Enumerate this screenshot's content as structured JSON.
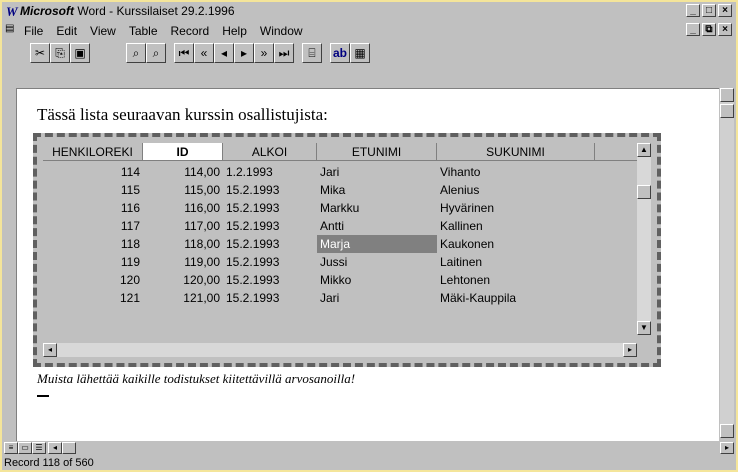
{
  "window": {
    "app_name": "Microsoft",
    "title_rest": " Word - Kurssilaiset 29.2.1996"
  },
  "menu": [
    "File",
    "Edit",
    "View",
    "Table",
    "Record",
    "Help",
    "Window"
  ],
  "toolbar": {
    "buttons": [
      "cut-icon",
      "copy-icon",
      "paste-icon",
      "find-icon",
      "find-next-icon",
      "first-record-icon",
      "prev-page-icon",
      "prev-record-icon",
      "next-record-icon",
      "next-page-icon",
      "last-record-icon",
      "print-preview-icon",
      "field-icon",
      "form-icon"
    ]
  },
  "document": {
    "heading": "Tässä lista seuraavan kurssin osallistujista:",
    "note": "Muista lähettää kaikille todistukset kiitettävillä arvosanoilla!"
  },
  "table": {
    "columns": [
      "HENKILOREKI",
      "ID",
      "ALKOI",
      "ETUNIMI",
      "SUKUNIMI"
    ],
    "rows": [
      [
        "114",
        "114,00",
        "1.2.1993",
        "Jari",
        "Vihanto"
      ],
      [
        "115",
        "115,00",
        "15.2.1993",
        "Mika",
        "Alenius"
      ],
      [
        "116",
        "116,00",
        "15.2.1993",
        "Markku",
        "Hyvärinen"
      ],
      [
        "117",
        "117,00",
        "15.2.1993",
        "Antti",
        "Kallinen"
      ],
      [
        "118",
        "118,00",
        "15.2.1993",
        "Marja",
        "Kaukonen"
      ],
      [
        "119",
        "119,00",
        "15.2.1993",
        "Jussi",
        "Laitinen"
      ],
      [
        "120",
        "120,00",
        "15.2.1993",
        "Mikko",
        "Lehtonen"
      ],
      [
        "121",
        "121,00",
        "15.2.1993",
        "Jari",
        "Mäki-Kauppila"
      ]
    ],
    "selected_row": 4,
    "selected_col": 3
  },
  "status": {
    "text": "Record 118 of 560"
  },
  "colors": {
    "frame": "#f4e59a",
    "selection": "#808080",
    "title_icon": "#000080"
  }
}
